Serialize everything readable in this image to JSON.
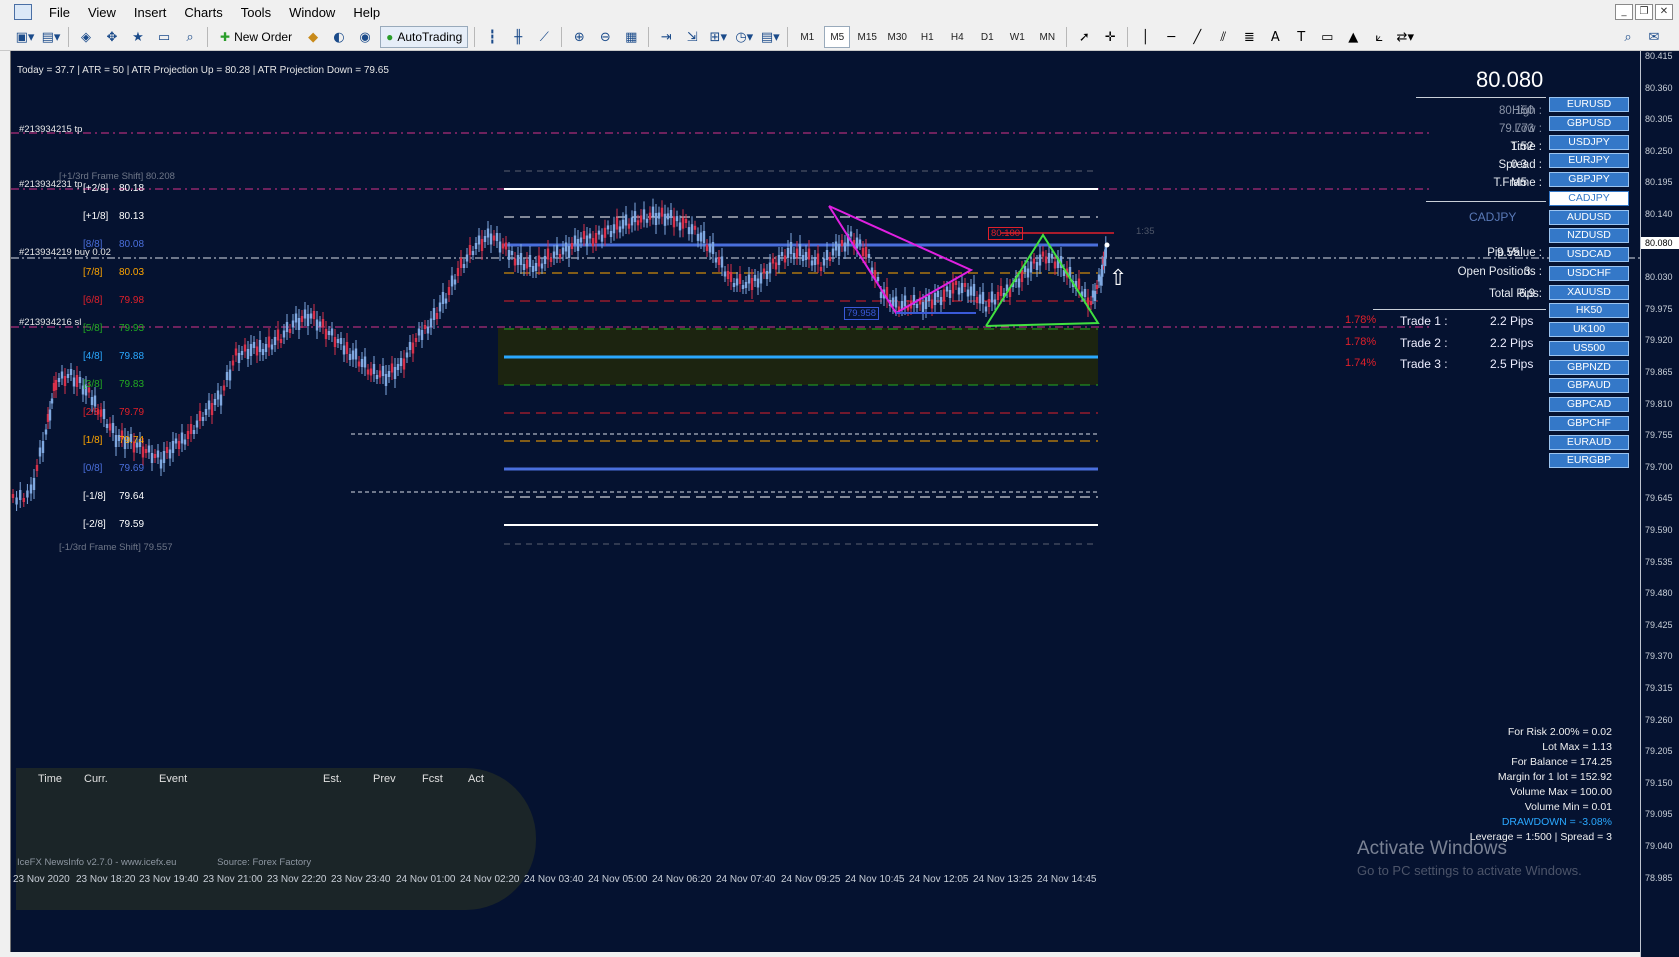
{
  "menu": [
    "File",
    "View",
    "Insert",
    "Charts",
    "Tools",
    "Window",
    "Help"
  ],
  "toolbar": {
    "new_order": "New Order",
    "autotrading": "AutoTrading",
    "timeframes": [
      "M1",
      "M5",
      "M15",
      "M30",
      "H1",
      "H4",
      "D1",
      "W1",
      "MN"
    ],
    "active_timeframe": "M5"
  },
  "info_line": "Today = 37.7  |  ATR = 50  |  ATR Projection Up = 80.28  |  ATR Projection Down = 79.65",
  "murrey_levels": [
    {
      "label": "[+2/8]",
      "value": "80.18",
      "color": "#ffffff"
    },
    {
      "label": "[+1/8]",
      "value": "80.13",
      "color": "#ffffff"
    },
    {
      "label": "[8/8]",
      "value": "80.08",
      "color": "#4a6fdc"
    },
    {
      "label": "[7/8]",
      "value": "80.03",
      "color": "#ffa500"
    },
    {
      "label": "[6/8]",
      "value": "79.98",
      "color": "#e0202a"
    },
    {
      "label": "[5/8]",
      "value": "79.93",
      "color": "#22aa22"
    },
    {
      "label": "[4/8]",
      "value": "79.88",
      "color": "#2aa8ff"
    },
    {
      "label": "[3/8]",
      "value": "79.83",
      "color": "#22aa22"
    },
    {
      "label": "[2/8]",
      "value": "79.79",
      "color": "#e0202a"
    },
    {
      "label": "[1/8]",
      "value": "79.74",
      "color": "#ffa500"
    },
    {
      "label": "[0/8]",
      "value": "79.69",
      "color": "#4a6fdc"
    },
    {
      "label": "[-1/8]",
      "value": "79.64",
      "color": "#ffffff"
    },
    {
      "label": "[-2/8]",
      "value": "79.59",
      "color": "#ffffff"
    }
  ],
  "frame_shift_up": "[+1/3rd Frame Shift]  80.208",
  "frame_shift_down": "[-1/3rd Frame Shift]  79.557",
  "order_labels": {
    "tp1": "#213934215 tp",
    "tp2": "#213934231 tp",
    "buy": "#213934219 buy 0.02",
    "sl": "#213934216 sl"
  },
  "chart_annotations": {
    "price_tag_high": "80.100",
    "price_tag_low": "79.958",
    "countdown": "1:35"
  },
  "panel": {
    "price": "80.080",
    "rows": [
      {
        "label": "High :",
        "value": "80.150",
        "dim": true
      },
      {
        "label": "Low :",
        "value": "79.773",
        "dim": true
      },
      {
        "label": "Time :",
        "value": "1:52",
        "dim": false
      },
      {
        "label": "Spread :",
        "value": "0.3",
        "dim": false
      },
      {
        "label": "T.Frame :",
        "value": "M5",
        "dim": false
      }
    ],
    "symbol": "CADJPY",
    "pip_value_label": "Pip Value :",
    "pip_value": "9.55",
    "open_positions_label": "Open Positions :",
    "open_positions": "3",
    "total_pips_label": "Total Pips:",
    "total_pips": "6.9",
    "trades": [
      {
        "pct": "1.78%",
        "label": "Trade 1 :",
        "pips": "2.2 Pips"
      },
      {
        "pct": "1.78%",
        "label": "Trade 2 :",
        "pips": "2.2 Pips"
      },
      {
        "pct": "1.74%",
        "label": "Trade 3 :",
        "pips": "2.5 Pips"
      }
    ]
  },
  "symbols": [
    "EURUSD",
    "GBPUSD",
    "USDJPY",
    "EURJPY",
    "GBPJPY",
    "CADJPY",
    "AUDUSD",
    "NZDUSD",
    "USDCAD",
    "USDCHF",
    "XAUUSD",
    "HK50",
    "UK100",
    "US500",
    "GBPNZD",
    "GBPAUD",
    "GBPCAD",
    "GBPCHF",
    "EURAUD",
    "EURGBP"
  ],
  "selected_symbol": "CADJPY",
  "price_axis": [
    "80.415",
    "80.360",
    "80.305",
    "80.250",
    "80.195",
    "80.140",
    "80.080",
    "80.030",
    "79.975",
    "79.920",
    "79.865",
    "79.810",
    "79.755",
    "79.700",
    "79.645",
    "79.590",
    "79.535",
    "79.480",
    "79.425",
    "79.370",
    "79.315",
    "79.260",
    "79.205",
    "79.150",
    "79.095",
    "79.040",
    "78.985"
  ],
  "current_price_axis": "80.080",
  "time_axis": [
    "23 Nov 2020",
    "23 Nov 18:20",
    "23 Nov 19:40",
    "23 Nov 21:00",
    "23 Nov 22:20",
    "23 Nov 23:40",
    "24 Nov 01:00",
    "24 Nov 02:20",
    "24 Nov 03:40",
    "24 Nov 05:00",
    "24 Nov 06:20",
    "24 Nov 07:40",
    "24 Nov 09:25",
    "24 Nov 10:45",
    "24 Nov 12:05",
    "24 Nov 13:25",
    "24 Nov 14:45"
  ],
  "news": {
    "headers": [
      "Time",
      "Curr.",
      "Event",
      "Est.",
      "Prev",
      "Fcst",
      "Act"
    ],
    "footer_left": "IceFX NewsInfo v2.7.0  -  www.icefx.eu",
    "footer_right": "Source: Forex Factory"
  },
  "risk_box": [
    "For Risk 2.00% = 0.02",
    "Lot Max = 1.13",
    "For Balance = 174.25",
    "Margin for 1 lot = 152.92",
    "Volume Max = 100.00",
    "Volume Min = 0.01",
    "DRAWDOWN = -3.08%",
    "Leverage = 1:500 | Spread = 3"
  ],
  "watermark": {
    "title": "Activate Windows",
    "subtitle": "Go to PC settings to activate Windows."
  }
}
